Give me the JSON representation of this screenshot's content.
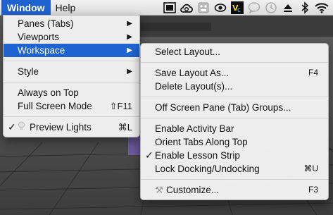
{
  "menubar": {
    "items": [
      {
        "label": "Window"
      },
      {
        "label": "Help"
      }
    ]
  },
  "status_icons": [
    "film-strip-icon",
    "creative-cloud-icon",
    "cassette-icon",
    "eye-icon",
    "vc-app-icon",
    "chat-bubble-icon",
    "time-machine-icon",
    "eject-icon",
    "bluetooth-icon",
    "wifi-icon"
  ],
  "window_menu": {
    "items": [
      {
        "label": "Panes (Tabs)"
      },
      {
        "label": "Viewports"
      },
      {
        "label": "Workspace"
      },
      {
        "label": "Style"
      },
      {
        "label": "Always on Top"
      },
      {
        "label": "Full Screen Mode",
        "shortcut": "⇧F11"
      },
      {
        "label": "Preview Lights",
        "shortcut": "⌘L"
      }
    ]
  },
  "workspace_submenu": {
    "items": [
      {
        "label": "Select Layout..."
      },
      {
        "label": "Save Layout As...",
        "shortcut": "F4"
      },
      {
        "label": "Delete Layout(s)..."
      },
      {
        "label": "Off Screen Pane (Tab) Groups..."
      },
      {
        "label": "Enable Activity Bar"
      },
      {
        "label": "Orient Tabs Along Top"
      },
      {
        "label": "Enable Lesson Strip"
      },
      {
        "label": "Lock Docking/Undocking",
        "shortcut": "⌘U"
      },
      {
        "label": "Customize...",
        "shortcut": "F3"
      }
    ]
  },
  "colors": {
    "highlight": "#1e63d0",
    "menu_bg": "#f0f0f0",
    "viewport_bg": "#565656"
  }
}
